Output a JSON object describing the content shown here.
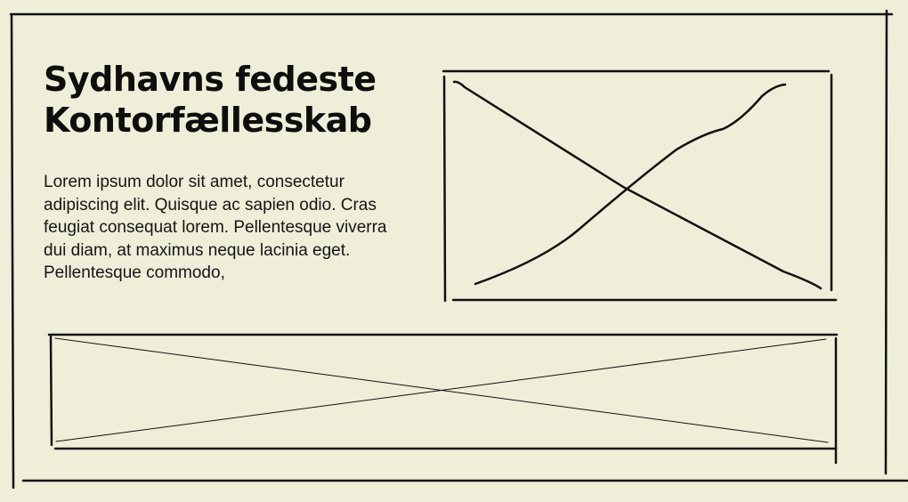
{
  "hero": {
    "title_line1": "Sydhavns fedeste",
    "title_line2": "Kontorfællesskab",
    "body": "Lorem ipsum dolor sit amet, consectetur adipiscing elit. Quisque ac sapien odio. Cras feugiat consequat lorem. Pellentesque viverra dui diam, at maximus neque lacinia eget. Pellentesque commodo,"
  },
  "colors": {
    "background": "#efeed8",
    "ink": "#111111"
  }
}
